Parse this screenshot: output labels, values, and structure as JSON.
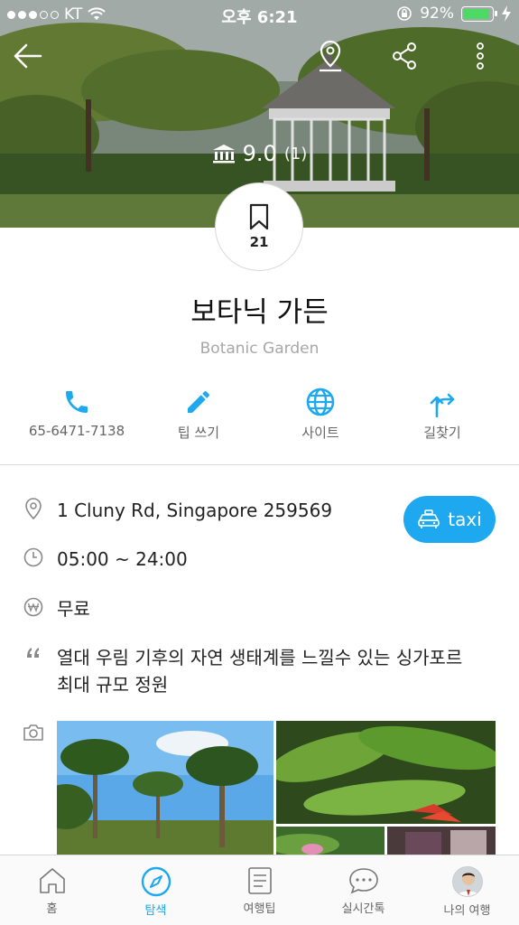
{
  "status_bar": {
    "carrier": "KT",
    "time": "오후 6:21",
    "battery": "92%",
    "battery_level": 0.92
  },
  "hero": {
    "rating_score": "9.0",
    "rating_count": "(1)",
    "icons": [
      "back-arrow-icon",
      "map-pin-icon",
      "share-icon",
      "more-vertical-icon"
    ]
  },
  "bookmark": {
    "count": "21"
  },
  "place": {
    "name_ko": "보타닉 가든",
    "name_en": "Botanic Garden"
  },
  "actions": [
    {
      "label": "65-6471-7138",
      "icon": "phone-icon"
    },
    {
      "label": "팁 쓰기",
      "icon": "pencil-icon"
    },
    {
      "label": "사이트",
      "icon": "globe-icon"
    },
    {
      "label": "길찾기",
      "icon": "directions-icon"
    }
  ],
  "info": {
    "address": "1 Cluny Rd, Singapore 259569",
    "hours": "05:00 ~ 24:00",
    "fee": "무료",
    "description": "열대 우림 기후의 자연 생태계를 느낄수 있는 싱가포르 최대 규모 정원",
    "taxi_label": "taxi"
  },
  "tabs": [
    {
      "label": "홈",
      "icon": "home-icon",
      "active": false
    },
    {
      "label": "탐색",
      "icon": "compass-icon",
      "active": true
    },
    {
      "label": "여행팁",
      "icon": "document-icon",
      "active": false
    },
    {
      "label": "실시간톡",
      "icon": "chat-icon",
      "active": false
    },
    {
      "label": "나의 여행",
      "icon": "avatar",
      "active": false
    }
  ],
  "colors": {
    "accent": "#1ea8f0",
    "battery_green": "#4cd964",
    "text_muted": "#a7a7a7"
  }
}
